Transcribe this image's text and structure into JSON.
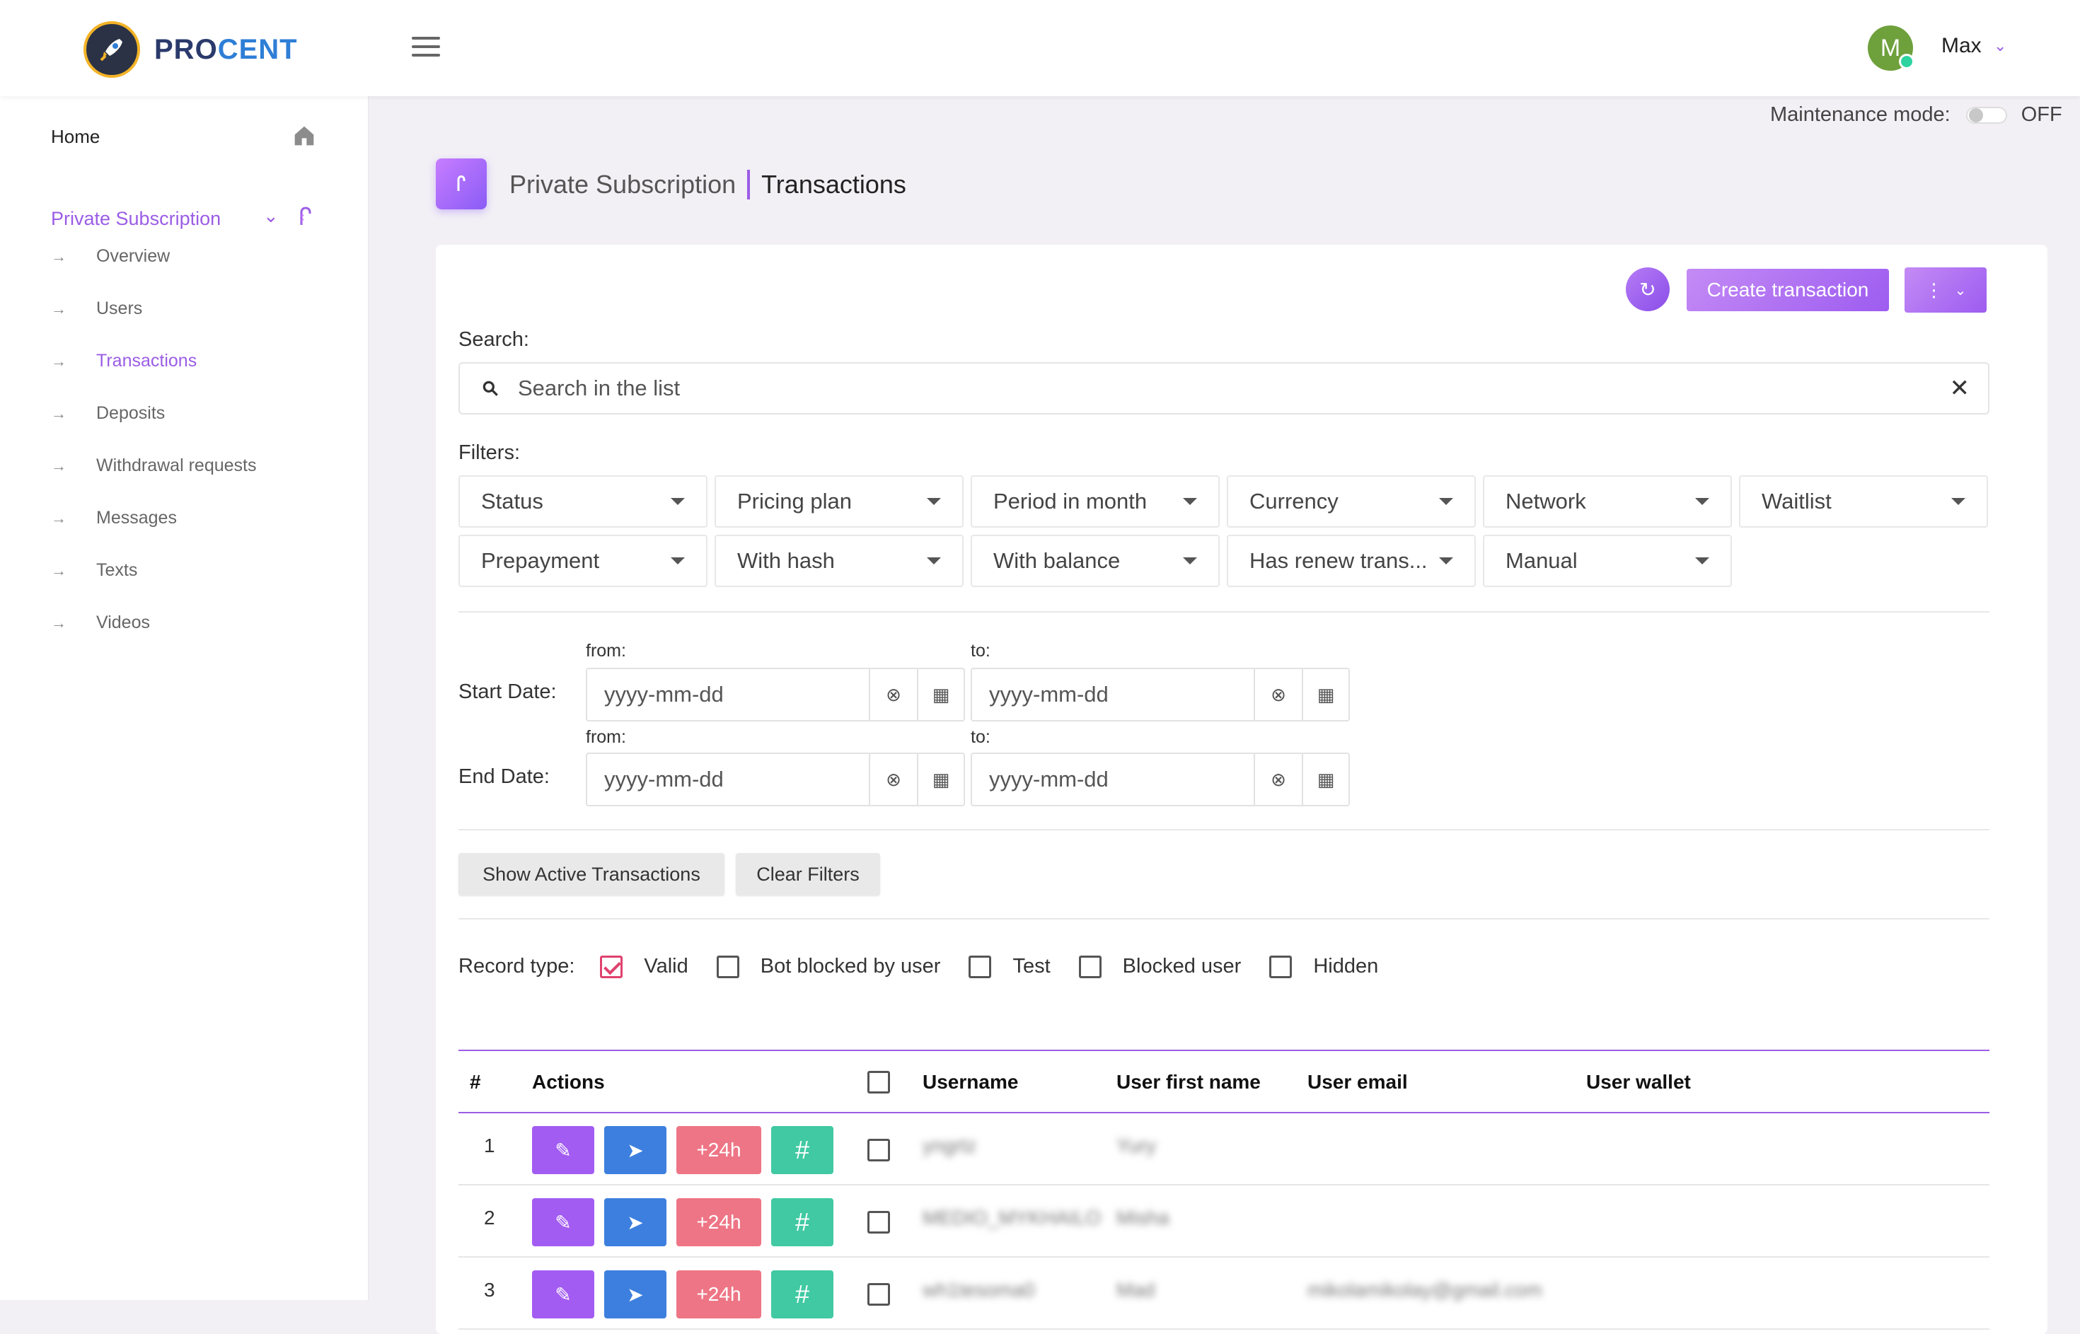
{
  "brand": {
    "part1": "PRO",
    "part2": "CENT"
  },
  "user": {
    "initial": "M",
    "name": "Max"
  },
  "sidebar": {
    "home": "Home",
    "section": "Private Subscription",
    "items": [
      {
        "label": "Overview",
        "active": false
      },
      {
        "label": "Users",
        "active": false
      },
      {
        "label": "Transactions",
        "active": true
      },
      {
        "label": "Deposits",
        "active": false
      },
      {
        "label": "Withdrawal requests",
        "active": false
      },
      {
        "label": "Messages",
        "active": false
      },
      {
        "label": "Texts",
        "active": false
      },
      {
        "label": "Videos",
        "active": false
      }
    ]
  },
  "maintenance": {
    "label": "Maintenance mode:",
    "state": "OFF"
  },
  "breadcrumb": {
    "parent": "Private Subscription",
    "current": "Transactions"
  },
  "toolbar": {
    "create_label": "Create transaction"
  },
  "search": {
    "label": "Search:",
    "placeholder": "Search in the list"
  },
  "filters": {
    "label": "Filters:",
    "row1": [
      "Status",
      "Pricing plan",
      "Period in month",
      "Currency",
      "Network",
      "Waitlist"
    ],
    "row2": [
      "Prepayment",
      "With hash",
      "With balance",
      "Has renew trans...",
      "Manual"
    ]
  },
  "dates": {
    "start_label": "Start Date:",
    "end_label": "End Date:",
    "from": "from:",
    "to": "to:",
    "placeholder": "yyyy-mm-dd"
  },
  "buttons": {
    "show_active": "Show Active Transactions",
    "clear": "Clear Filters"
  },
  "record_type": {
    "label": "Record type:",
    "options": [
      {
        "label": "Valid",
        "checked": true
      },
      {
        "label": "Bot blocked by user",
        "checked": false
      },
      {
        "label": "Test",
        "checked": false
      },
      {
        "label": "Blocked user",
        "checked": false
      },
      {
        "label": "Hidden",
        "checked": false
      }
    ]
  },
  "table": {
    "headers": [
      "#",
      "Actions",
      "Username",
      "User first name",
      "User email",
      "User wallet"
    ],
    "action_labels": {
      "plus": "+24h",
      "hash": "#"
    },
    "rows": [
      {
        "num": "1",
        "username": "yngrtz",
        "first_name": "Yury",
        "email": "",
        "wallet": ""
      },
      {
        "num": "2",
        "username": "MEDIO_MYKHAILO",
        "first_name": "Misha",
        "email": "",
        "wallet": ""
      },
      {
        "num": "3",
        "username": "wh1tesoma0",
        "first_name": "Mad",
        "email": "mikolamikolay@gmail.com",
        "wallet": ""
      }
    ]
  },
  "colors": {
    "accent": "#9b5de5",
    "edit": "#a35cf2",
    "send": "#3d7fde",
    "plus": "#ee7585",
    "hash": "#40c9a2",
    "checkbox": "#e0426e"
  }
}
